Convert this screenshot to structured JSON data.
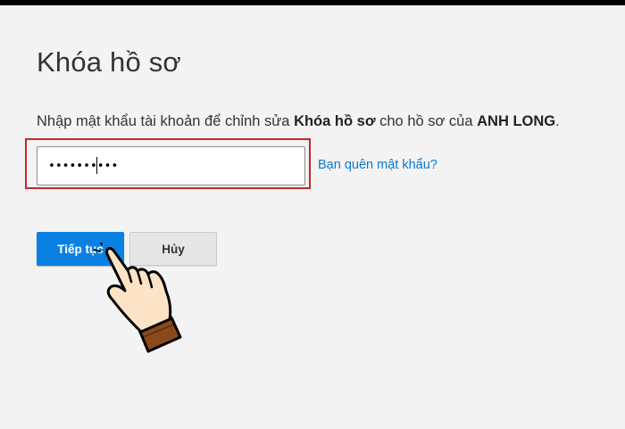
{
  "page": {
    "title": "Khóa hồ sơ",
    "instruction": {
      "part1": "Nhập mật khẩu tài khoản để chỉnh sửa ",
      "bold1": "Khóa hồ sơ",
      "part2": " cho hồ sơ của ",
      "bold2": "ANH LONG",
      "part3": "."
    },
    "password_field": {
      "value": "••••••••••",
      "placeholder": ""
    },
    "forgot_link": "Bạn quên mật khẩu?",
    "buttons": {
      "continue": "Tiếp tục",
      "cancel": "Hủy"
    }
  },
  "colors": {
    "primary_button": "#0b80e3",
    "link": "#0b78d1",
    "highlight_border": "#c0282d",
    "background": "#f3f3f3"
  },
  "icons": {
    "pointer": "pointing-hand-icon"
  }
}
